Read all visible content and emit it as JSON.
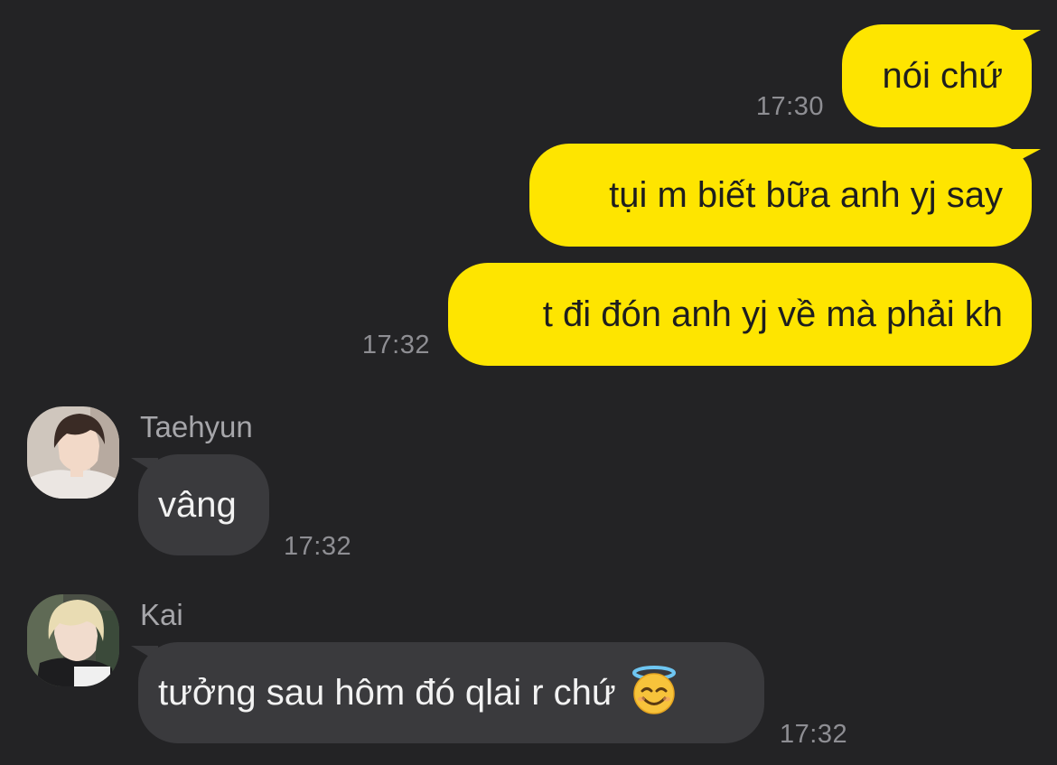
{
  "messages": {
    "m1": {
      "text": "nói chứ",
      "time": "17:30"
    },
    "m2": {
      "text": "tụi m biết bữa anh yj say"
    },
    "m3": {
      "text": "t đi đón anh yj về mà phải kh",
      "time": "17:32"
    },
    "m4": {
      "sender": "Taehyun",
      "text": "vâng",
      "time": "17:32"
    },
    "m5": {
      "sender": "Kai",
      "text": "tưởng sau hôm đó qlai r chứ",
      "emoji": "smiling-face-with-halo-icon",
      "time": "17:32"
    }
  },
  "colors": {
    "background": "#232325",
    "outgoing_bubble": "#fee500",
    "incoming_bubble": "#3a3a3d",
    "timestamp": "#8e8e93"
  }
}
